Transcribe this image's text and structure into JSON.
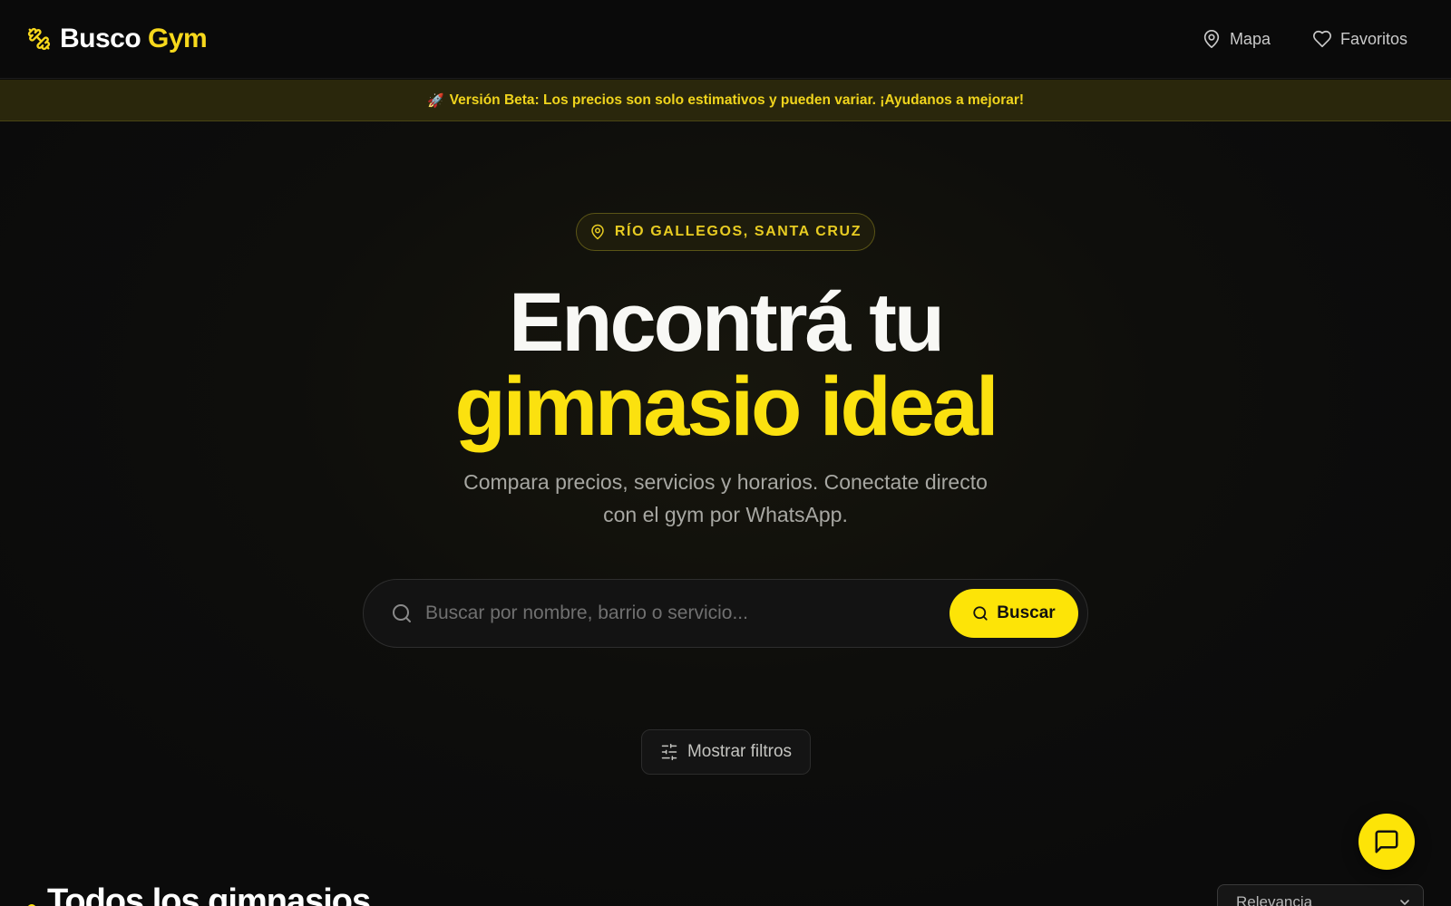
{
  "header": {
    "logo_word1": "Busco",
    "logo_word2": "Gym",
    "logo_icon": "dumbbell-icon",
    "nav": [
      {
        "label": "Mapa",
        "icon": "map-pin-icon"
      },
      {
        "label": "Favoritos",
        "icon": "heart-icon"
      }
    ]
  },
  "beta_banner": {
    "icon": "rocket-icon",
    "text": "Versión Beta: Los precios son solo estimativos y pueden variar. ¡Ayudanos a mejorar!"
  },
  "hero": {
    "location": "RÍO GALLEGOS, SANTA CRUZ",
    "title_line1": "Encontrá tu",
    "title_line2": "gimnasio ideal",
    "subtitle": "Compara precios, servicios y horarios. Conectate directo con el gym por WhatsApp."
  },
  "search": {
    "placeholder": "Buscar por nombre, barrio o servicio...",
    "value": "",
    "button_label": "Buscar"
  },
  "filters": {
    "toggle_label": "Mostrar filtros",
    "icon": "sliders-icon"
  },
  "listing": {
    "title": "Todos los gimnasios",
    "sort_selected": "Relevancia"
  },
  "chat": {
    "icon": "chat-icon"
  },
  "colors": {
    "accent": "#fde407",
    "background": "#0b0b0b",
    "banner_bg": "#2a270c",
    "banner_text": "#f0d41d"
  }
}
